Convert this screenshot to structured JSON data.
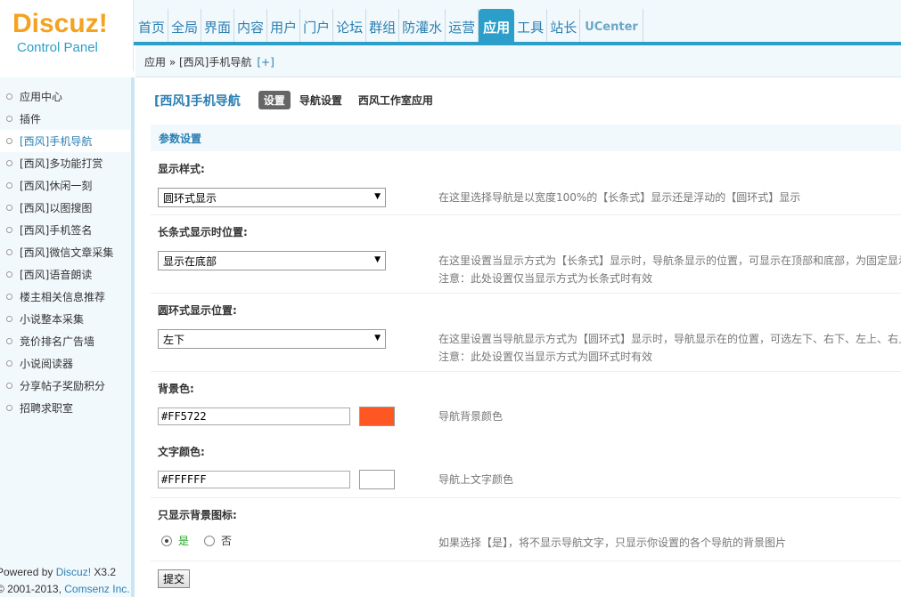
{
  "logo": {
    "main": "Discuz",
    "bang": "!",
    "sub": "Control Panel"
  },
  "nav": {
    "items": [
      "首页",
      "全局",
      "界面",
      "内容",
      "用户",
      "门户",
      "论坛",
      "群组",
      "防灌水",
      "运营",
      "应用",
      "工具",
      "站长"
    ],
    "active_index": 10,
    "ucenter": "UCenter"
  },
  "breadcrumb": {
    "text": "应用 » [西风]手机导航",
    "plus": "[+]"
  },
  "sidebar": {
    "items": [
      "应用中心",
      "插件",
      "[西风]手机导航",
      "[西风]多功能打赏",
      "[西风]休闲一刻",
      "[西风]以图搜图",
      "[西风]手机签名",
      "[西风]微信文章采集",
      "[西风]语音朗读",
      "楼主相关信息推荐",
      "小说整本采集",
      "竞价排名广告墙",
      "小说阅读器",
      "分享帖子奖励积分",
      "招聘求职室"
    ],
    "active_index": 2,
    "footer_prefix": "Powered by ",
    "footer_link": "Discuz!",
    "footer_version": " X3.2",
    "footer_copy": "© 2001-2013, ",
    "footer_company": "Comsenz Inc."
  },
  "main": {
    "plugin_title": "[西风]手机导航",
    "tabs": [
      "设置",
      "导航设置",
      "西风工作室应用"
    ],
    "section": "参数设置",
    "display_style": {
      "label": "显示样式:",
      "value": "圆环式显示",
      "hint": "在这里选择导航是以宽度100%的【长条式】显示还是浮动的【圆环式】显示"
    },
    "bar_position": {
      "label": "长条式显示时位置:",
      "value": "显示在底部",
      "hint1": "在这里设置当显示方式为【长条式】显示时，导航条显示的位置，可显示在顶部和底部，为固定显示",
      "hint2": "注意：此处设置仅当显示方式为长条式时有效"
    },
    "ring_position": {
      "label": "圆环式显示位置:",
      "value": "左下",
      "hint1": "在这里设置当导航显示方式为【圆环式】显示时，导航显示在的位置，可选左下、右下、左上、右上",
      "hint2": "注意：此处设置仅当显示方式为圆环式时有效"
    },
    "bg_color": {
      "label": "背景色:",
      "value": "#FF5722",
      "hint": "导航背景颜色"
    },
    "text_color": {
      "label": "文字颜色:",
      "value": "#FFFFFF",
      "hint": "导航上文字颜色"
    },
    "icon_only": {
      "label": "只显示背景图标:",
      "yes": "是",
      "no": "否",
      "selected": "yes",
      "hint": "如果选择【是】，将不显示导航文字，只显示你设置的各个导航的背景图片"
    },
    "submit": "提交"
  },
  "colors": {
    "accent": "#2b9fc9",
    "logo": "#f4a21f",
    "bg_swatch": "#FF5722",
    "text_swatch": "#FFFFFF"
  }
}
